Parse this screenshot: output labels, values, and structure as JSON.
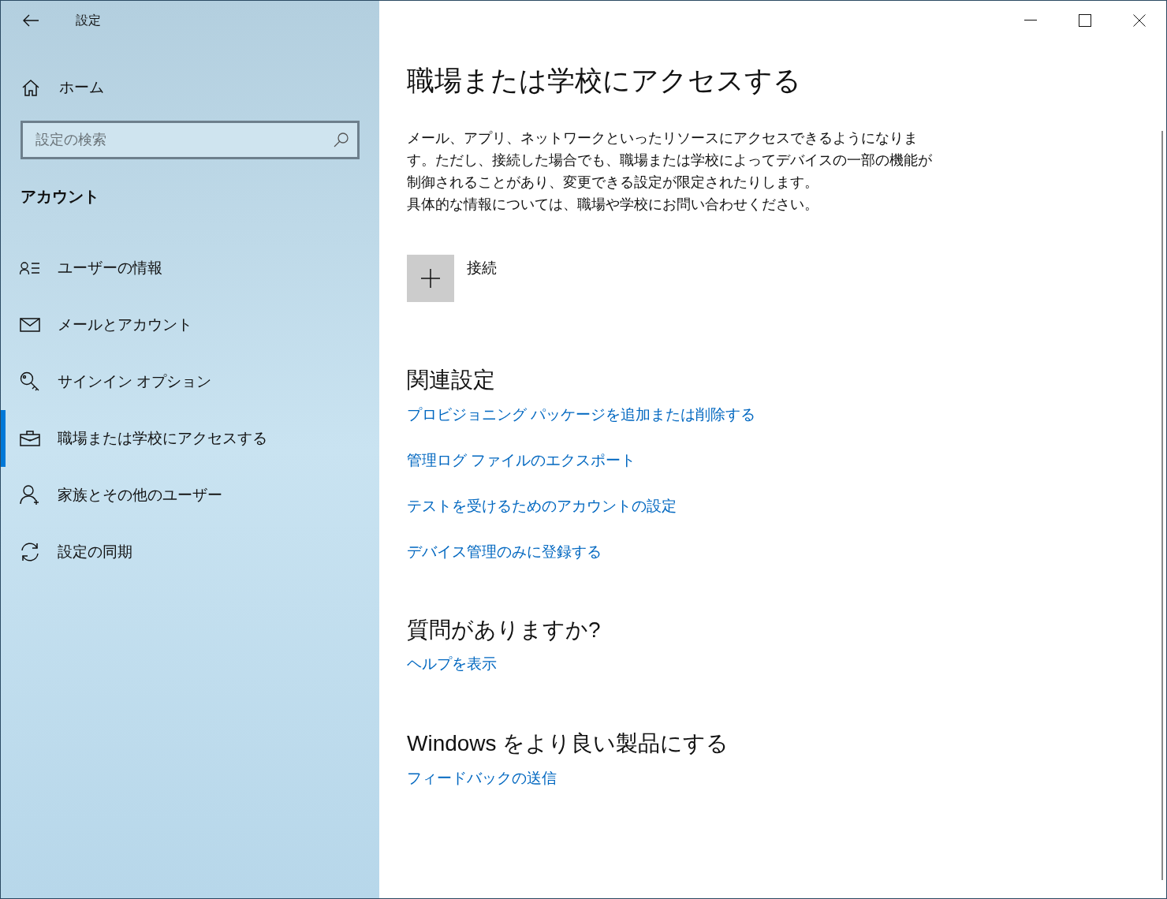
{
  "window": {
    "title": "設定"
  },
  "sidebar": {
    "home": "ホーム",
    "search": {
      "placeholder": "設定の検索"
    },
    "section": "アカウント",
    "items": [
      {
        "label": "ユーザーの情報",
        "selected": false
      },
      {
        "label": "メールとアカウント",
        "selected": false
      },
      {
        "label": "サインイン オプション",
        "selected": false
      },
      {
        "label": "職場または学校にアクセスする",
        "selected": true
      },
      {
        "label": "家族とその他のユーザー",
        "selected": false
      },
      {
        "label": "設定の同期",
        "selected": false
      }
    ]
  },
  "main": {
    "title": "職場または学校にアクセスする",
    "description": [
      "メール、アプリ、ネットワークといったリソースにアクセスできるようになります。ただし、接続した場合でも、職場または学校によってデバイスの一部の機能が制御されることがあり、変更できる設定が限定されたりします。",
      "具体的な情報については、職場や学校にお問い合わせください。"
    ],
    "connect": "接続",
    "sections": [
      {
        "heading": "関連設定",
        "links": [
          "プロビジョニング パッケージを追加または削除する",
          "管理ログ ファイルのエクスポート",
          "テストを受けるためのアカウントの設定",
          "デバイス管理のみに登録する"
        ]
      },
      {
        "heading": "質問がありますか?",
        "links": [
          "ヘルプを表示"
        ]
      },
      {
        "heading": "Windows をより良い製品にする",
        "links": [
          "フィードバックの送信"
        ]
      }
    ]
  }
}
